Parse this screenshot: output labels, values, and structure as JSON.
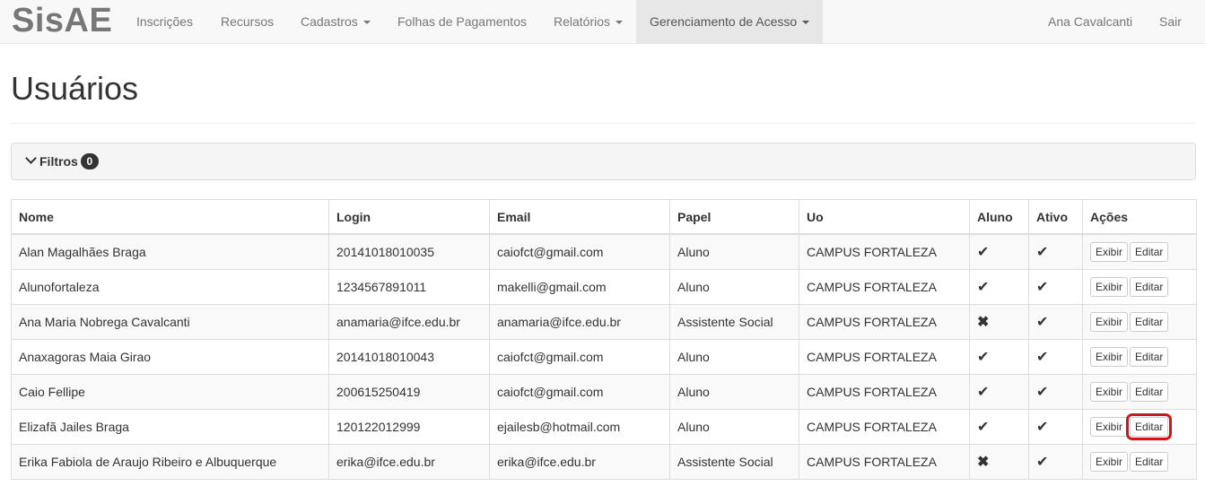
{
  "navbar": {
    "brand": "SisAE",
    "items": [
      {
        "label": "Inscrições"
      },
      {
        "label": "Recursos"
      },
      {
        "label": "Cadastros"
      },
      {
        "label": "Folhas de Pagamentos"
      },
      {
        "label": "Relatórios"
      },
      {
        "label": "Gerenciamento de Acesso"
      }
    ],
    "user": "Ana Cavalcanti",
    "logout": "Sair"
  },
  "page": {
    "title": "Usuários"
  },
  "filters": {
    "label": "Filtros",
    "count": "0"
  },
  "table": {
    "headers": [
      "Nome",
      "Login",
      "Email",
      "Papel",
      "Uo",
      "Aluno",
      "Ativo",
      "Ações"
    ],
    "view_label": "Exibir",
    "edit_label": "Editar",
    "rows": [
      {
        "nome": "Alan Magalhães Braga",
        "login": "20141018010035",
        "email": "caiofct@gmail.com",
        "papel": "Aluno",
        "uo": "CAMPUS FORTALEZA",
        "aluno": "✔",
        "ativo": "✔"
      },
      {
        "nome": "Alunofortaleza",
        "login": "1234567891011",
        "email": "makelli@gmail.com",
        "papel": "Aluno",
        "uo": "CAMPUS FORTALEZA",
        "aluno": "✔",
        "ativo": "✔"
      },
      {
        "nome": "Ana Maria Nobrega Cavalcanti",
        "login": "anamaria@ifce.edu.br",
        "email": "anamaria@ifce.edu.br",
        "papel": "Assistente Social",
        "uo": "CAMPUS FORTALEZA",
        "aluno": "✖",
        "ativo": "✔"
      },
      {
        "nome": "Anaxagoras Maia Girao",
        "login": "20141018010043",
        "email": "caiofct@gmail.com",
        "papel": "Aluno",
        "uo": "CAMPUS FORTALEZA",
        "aluno": "✔",
        "ativo": "✔"
      },
      {
        "nome": "Caio Fellipe",
        "login": "200615250419",
        "email": "caiofct@gmail.com",
        "papel": "Aluno",
        "uo": "CAMPUS FORTALEZA",
        "aluno": "✔",
        "ativo": "✔"
      },
      {
        "nome": "Elizafã Jailes Braga",
        "login": "120122012999",
        "email": "ejailesb@hotmail.com",
        "papel": "Aluno",
        "uo": "CAMPUS FORTALEZA",
        "aluno": "✔",
        "ativo": "✔"
      },
      {
        "nome": "Erika Fabiola de Araujo Ribeiro e Albuquerque",
        "login": "erika@ifce.edu.br",
        "email": "erika@ifce.edu.br",
        "papel": "Assistente Social",
        "uo": "CAMPUS FORTALEZA",
        "aluno": "✖",
        "ativo": "✔"
      }
    ]
  },
  "colors": {
    "navbar_bg": "#f8f8f8",
    "active_nav_bg": "#e7e7e7",
    "stripe_bg": "#f9f9f9",
    "highlight": "#d0161b"
  }
}
